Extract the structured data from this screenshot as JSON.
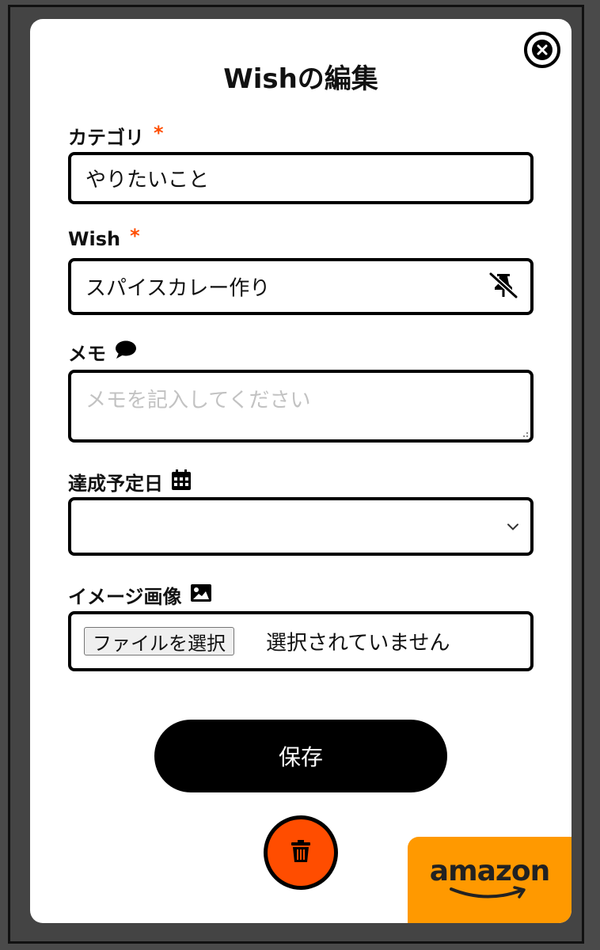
{
  "modal": {
    "title": "Wishの編集"
  },
  "fields": {
    "category": {
      "label": "カテゴリ",
      "required_mark": "*",
      "value": "やりたいこと"
    },
    "wish": {
      "label": "Wish",
      "required_mark": "*",
      "value": "スパイスカレー作り",
      "icon": "pin-off-icon"
    },
    "memo": {
      "label": "メモ",
      "icon": "speech-bubble-icon",
      "placeholder": "メモを記入してください"
    },
    "due_date": {
      "label": "達成予定日",
      "icon": "calendar-icon",
      "value": ""
    },
    "image": {
      "label": "イメージ画像",
      "icon": "image-icon",
      "button_label": "ファイルを選択",
      "status": "選択されていません"
    }
  },
  "buttons": {
    "save_label": "保存",
    "delete_icon": "trash-icon",
    "close_icon": "close-icon"
  },
  "amazon": {
    "label": "amazon"
  },
  "colors": {
    "accent": "#ff4d00",
    "amazon": "#ff9900",
    "primary": "#000000"
  }
}
